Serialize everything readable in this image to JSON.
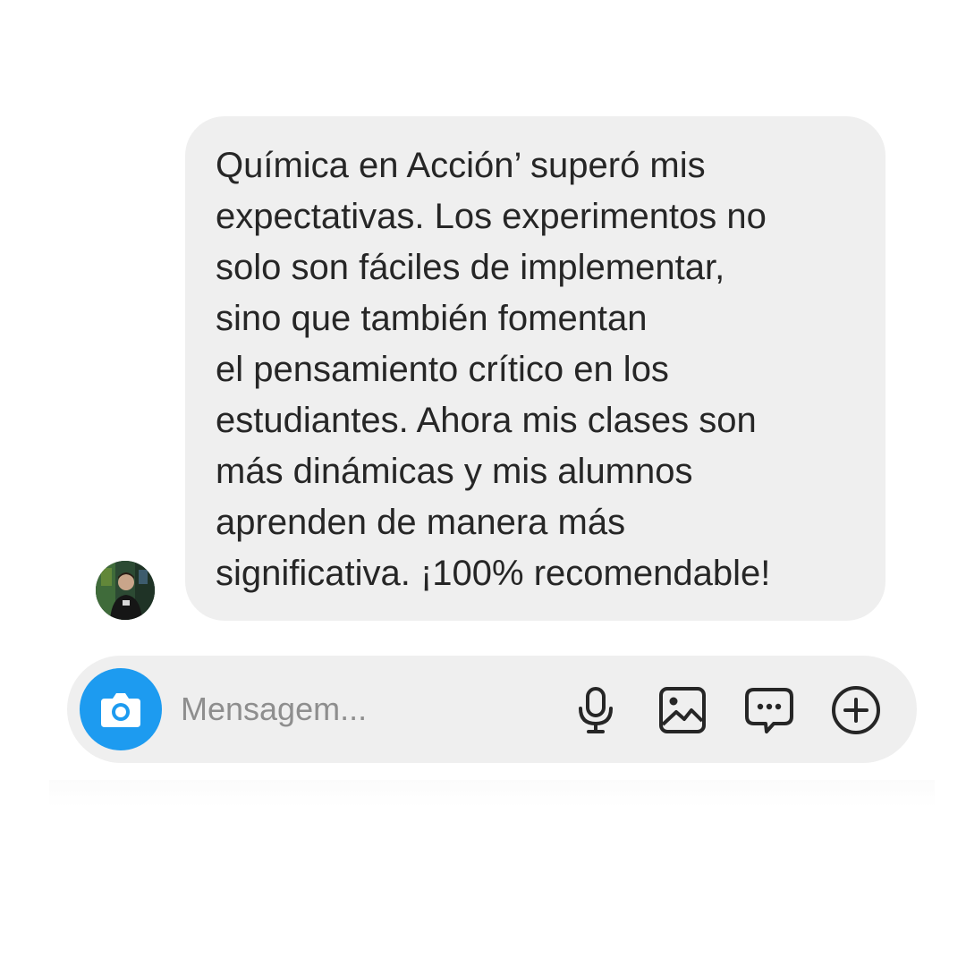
{
  "message": {
    "lines": [
      "Química en Acción’ superó mis",
      "expectativas. Los experimentos no",
      "solo son fáciles de implementar,",
      "sino que también fomentan",
      "el pensamiento crítico en los",
      "estudiantes. Ahora mis clases son",
      "más dinámicas y mis alumnos",
      "aprenden de manera más",
      "significativa. ¡100% recomendable!"
    ]
  },
  "sender": {
    "avatar_icon": "profile-photo"
  },
  "composer": {
    "placeholder": "Mensagem...",
    "value": "",
    "camera_icon": "camera-icon",
    "mic_icon": "microphone-icon",
    "gallery_icon": "image-icon",
    "sticker_icon": "chat-bubble-dots-icon",
    "more_icon": "plus-circle-icon"
  },
  "colors": {
    "bubble": "#efefef",
    "text": "#262626",
    "placeholder": "#8e8e8e",
    "accent": "#1d9bf0"
  }
}
